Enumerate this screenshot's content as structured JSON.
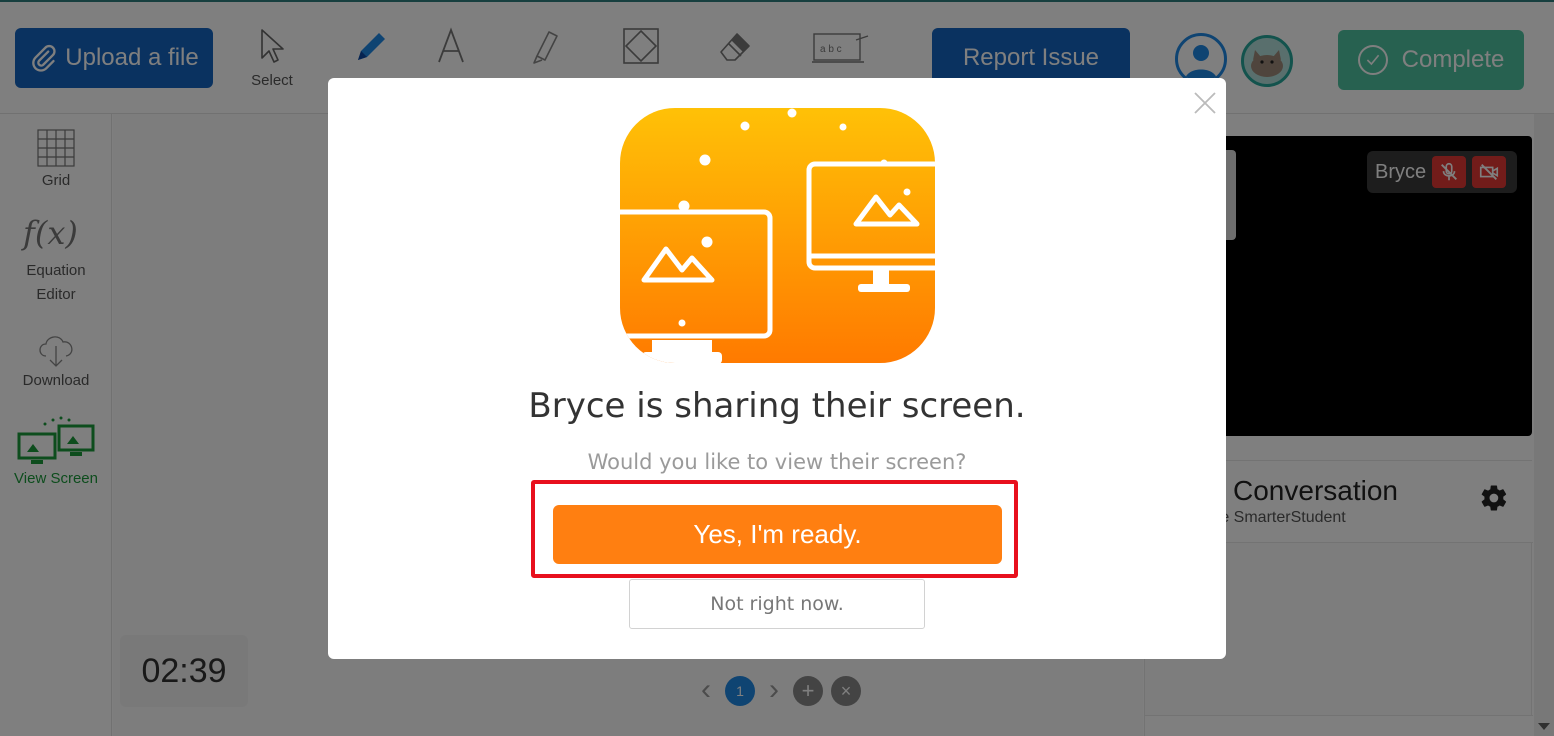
{
  "toolbar": {
    "upload_label": "Upload a file",
    "select_label": "Select",
    "report_label": "Report Issue",
    "complete_label": "Complete"
  },
  "sidebar": {
    "items": [
      {
        "label": "Grid"
      },
      {
        "label": "Equation"
      },
      {
        "label": "Editor"
      },
      {
        "label": "Download"
      },
      {
        "label": "View Screen"
      }
    ]
  },
  "canvas": {
    "timer": "02:39",
    "page_number": "1"
  },
  "video": {
    "participant_name": "Bryce"
  },
  "chat": {
    "title": "Conversation",
    "subtitle": "rce SmarterStudent"
  },
  "modal": {
    "title": "Bryce is sharing their screen.",
    "subtitle": "Would you like to view their screen?",
    "confirm_label": "Yes, I'm ready.",
    "decline_label": "Not right now."
  },
  "colors": {
    "primary_blue": "#1565c0",
    "complete_green": "#4fc3a1",
    "orange": "#ff7f11",
    "highlight_red": "#e8101d",
    "active_green": "#1b9a3a"
  },
  "icons": {
    "upload": "paperclip-icon",
    "select": "cursor-arrow-icon",
    "pen": "pencil-icon",
    "text": "text-letter-icon",
    "highlighter": "highlighter-icon",
    "shape": "shape-icon",
    "eraser": "eraser-icon",
    "whiteboard": "whiteboard-icon",
    "grid": "grid-icon",
    "equation": "function-icon",
    "download": "cloud-download-icon",
    "view_screen": "screens-icon",
    "settings": "gear-icon",
    "close": "close-icon"
  }
}
